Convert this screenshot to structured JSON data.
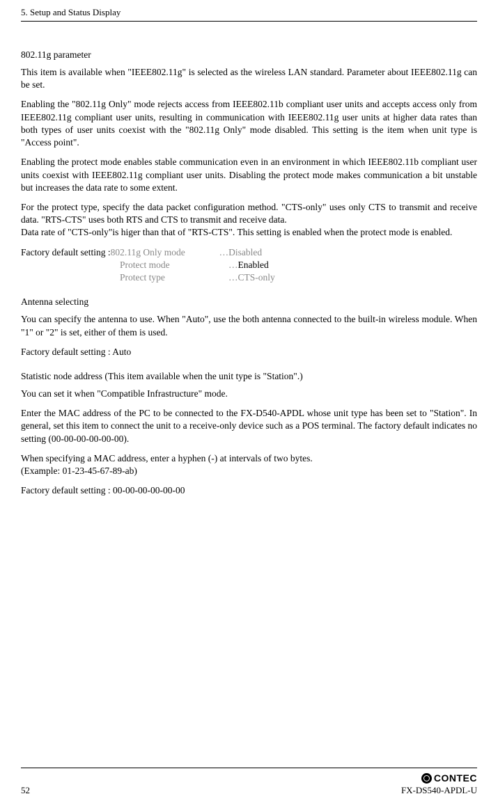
{
  "header": {
    "title": "5. Setup and Status Display"
  },
  "section1": {
    "title": "802.11g parameter",
    "p1": "This item is available when \"IEEE802.11g\" is selected as the wireless LAN standard.  Parameter about IEEE802.11g can be set.",
    "p2": "Enabling the \"802.11g Only\" mode rejects access from IEEE802.11b compliant user units and accepts access only from IEEE802.11g compliant user units, resulting in communication with IEEE802.11g user units at higher data rates than both types of user units coexist with the \"802.11g Only\" mode disabled.  This setting is the item when unit type is \"Access point\".",
    "p3": "Enabling the protect mode enables stable communication even in an environment in which IEEE802.11b compliant user units coexist with IEEE802.11g compliant user units.  Disabling the protect mode makes communication a bit unstable but increases the data rate to some extent.",
    "p4": "For the protect type, specify the data packet configuration method.  \"CTS-only\" uses only CTS to transmit and receive data.  \"RTS-CTS\" uses both RTS and CTS to transmit and receive data.\nData rate of \"CTS-only\"is higer than that of \"RTS-CTS\".  This setting is enabled when the protect mode is enabled.",
    "defaults_label": "Factory default setting : ",
    "defaults": [
      {
        "key": "802.11g Only mode",
        "val": "Disabled",
        "valGray": true
      },
      {
        "key": "Protect mode",
        "val": "Enabled",
        "valGray": false
      },
      {
        "key": "Protect type",
        "val": "CTS-only",
        "valGray": true
      }
    ]
  },
  "section2": {
    "title": "Antenna selecting",
    "p1": "You can specify the antenna to use.  When \"Auto\", use the both antenna connected to the built-in wireless module.  When \"1\" or \"2\" is set, either of them is used.",
    "p2": "Factory default setting : Auto"
  },
  "section3": {
    "title": "Statistic node address (This item available when the unit type is \"Station\".)",
    "p1": "You can set it when \"Compatible Infrastructure\" mode.",
    "p2": "Enter the MAC address of the PC to be connected to the FX-D540-APDL whose unit type has been set to \"Station\".  In general, set this item to connect the unit to a receive-only device such as a POS terminal.  The factory default indicates no setting (00-00-00-00-00-00).",
    "p3": "When specifying a MAC address, enter a hyphen (-) at intervals of two bytes.\n(Example: 01-23-45-67-89-ab)",
    "p4": "Factory default setting : 00-00-00-00-00-00"
  },
  "footer": {
    "page": "52",
    "brand": "CONTEC",
    "model": "FX-DS540-APDL-U"
  }
}
